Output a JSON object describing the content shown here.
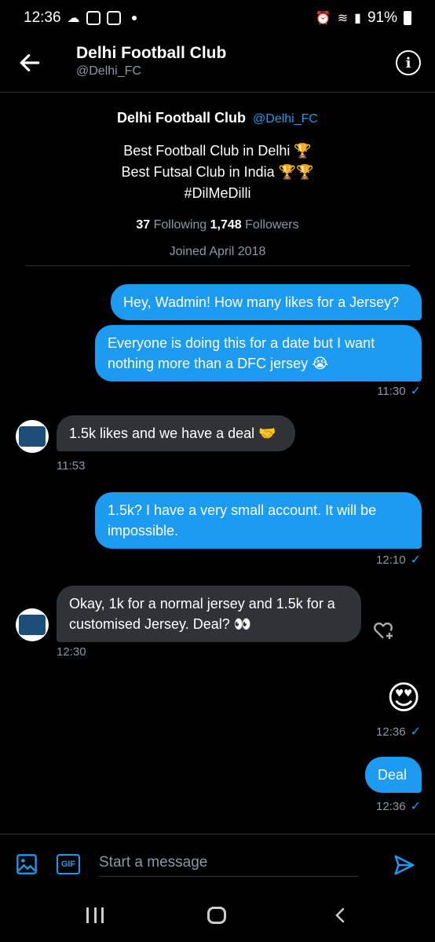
{
  "status_bar": {
    "time": "12:36",
    "battery": "91%"
  },
  "header": {
    "title": "Delhi Football Club",
    "handle": "@Delhi_FC",
    "icons": [
      "back-arrow-icon",
      "info-icon"
    ]
  },
  "profile": {
    "name": "Delhi Football Club",
    "handle": "@Delhi_FC",
    "bio_line1": "Best Football Club in Delhi 🏆",
    "bio_line2": "Best Futsal Club in India 🏆🏆",
    "bio_line3": "#DilMeDilli",
    "following_count": "37",
    "following_label": "Following",
    "followers_count": "1,748",
    "followers_label": "Followers",
    "joined": "Joined April 2018"
  },
  "messages": {
    "m1": "Hey, Wadmin! How many likes for a Jersey?",
    "m2": "Everyone is doing this for a date but I want nothing more than a DFC jersey 😭",
    "t1": "11:30",
    "m3": "1.5k likes and we have a deal 🤝",
    "t2": "11:53",
    "m4": "1.5k? I have a very small account. It will be impossible.",
    "t3": "12:10",
    "m5": "Okay, 1k for a normal jersey and 1.5k for a customised Jersey. Deal? 👀",
    "t4": "12:30",
    "m6": "😍",
    "t5": "12:36",
    "m7": "Deal",
    "t6": "12:36",
    "check": "✓"
  },
  "composer": {
    "placeholder": "Start a message",
    "gif_label": "GIF"
  },
  "colors": {
    "accent": "#1d9bf0",
    "incoming_bubble": "#2f3336",
    "background": "#000000",
    "muted_text": "#8b98a5"
  }
}
